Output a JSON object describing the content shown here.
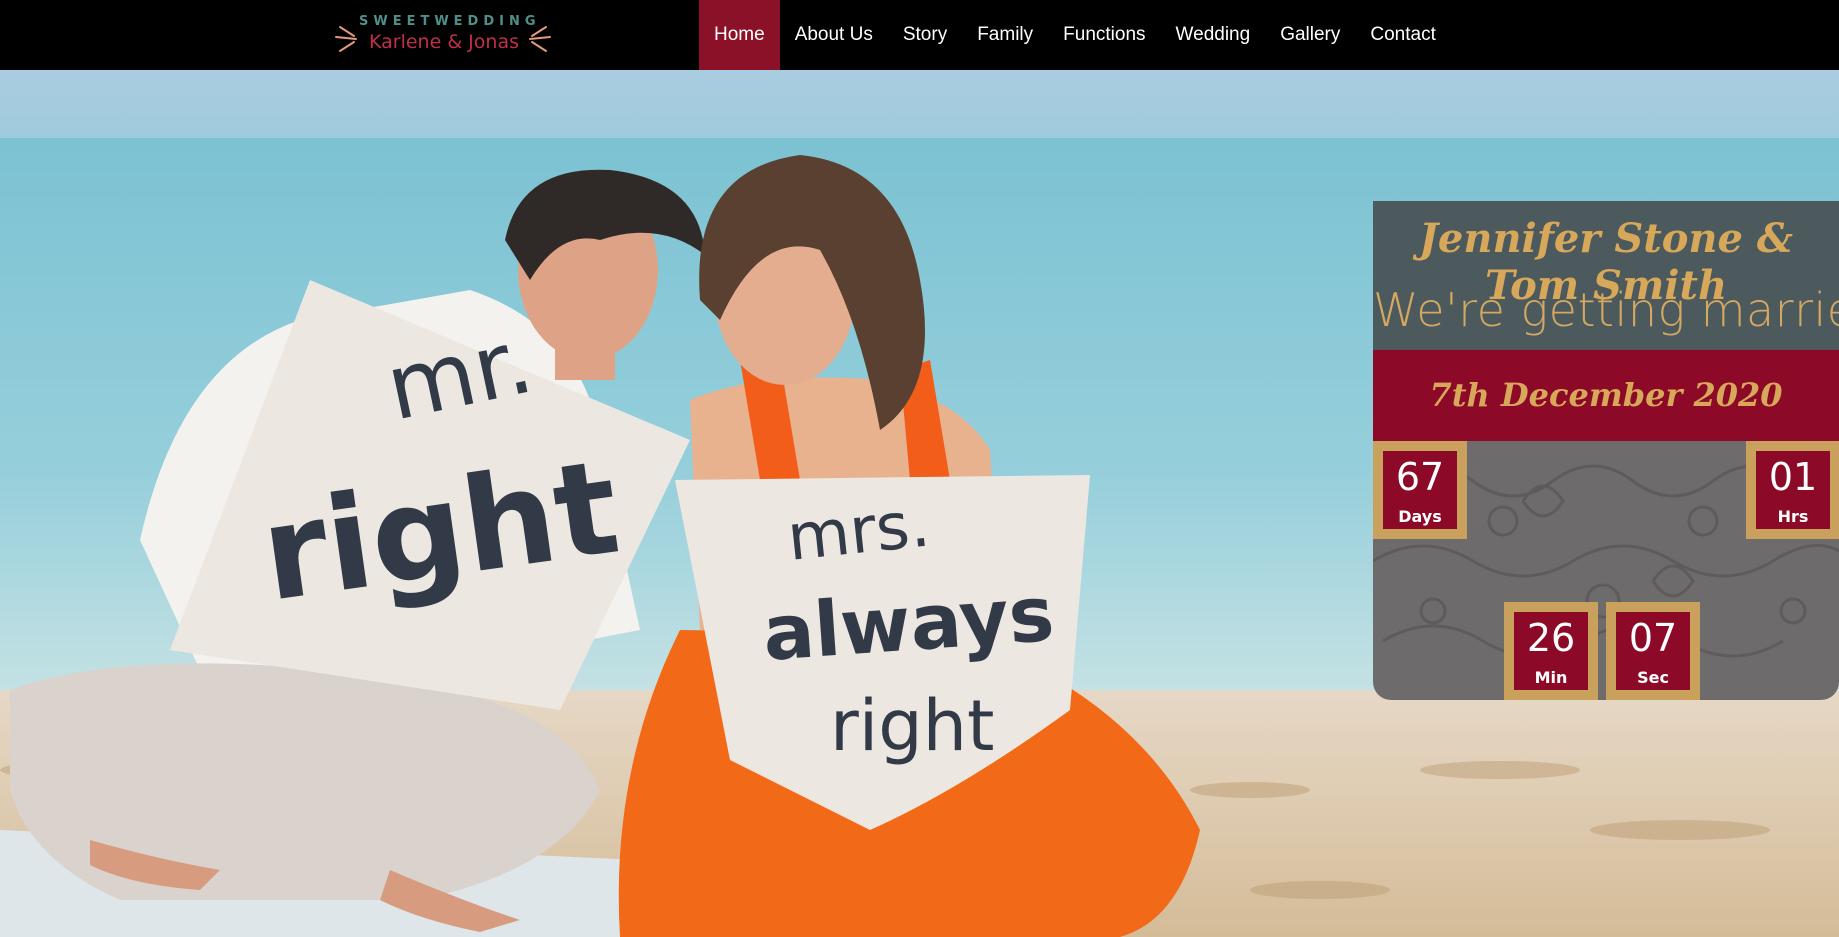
{
  "logo": {
    "top_text": "SWEETWEDDING",
    "bottom_text": "Karlene & Jonas"
  },
  "nav": {
    "items": [
      {
        "label": "Home",
        "active": true
      },
      {
        "label": "About Us",
        "active": false
      },
      {
        "label": "Story",
        "active": false
      },
      {
        "label": "Family",
        "active": false
      },
      {
        "label": "Functions",
        "active": false
      },
      {
        "label": "Wedding",
        "active": false
      },
      {
        "label": "Gallery",
        "active": false
      },
      {
        "label": "Contact",
        "active": false
      }
    ]
  },
  "hero": {
    "pillow_left": [
      "mr.",
      "right"
    ],
    "pillow_right": [
      "mrs.",
      "always",
      "right"
    ]
  },
  "countdown": {
    "names": "Jennifer Stone & Tom Smith",
    "tagline": "We're getting married",
    "date": "7th December 2020",
    "days": {
      "value": "67",
      "label": "Days"
    },
    "hours": {
      "value": "01",
      "label": "Hrs"
    },
    "minutes": {
      "value": "26",
      "label": "Min"
    },
    "seconds": {
      "value": "07",
      "label": "Sec"
    }
  },
  "colors": {
    "nav_bg": "#000000",
    "accent": "#8c0a27",
    "gold": "#c9a15d",
    "panel_slate": "#4c5a5e"
  }
}
